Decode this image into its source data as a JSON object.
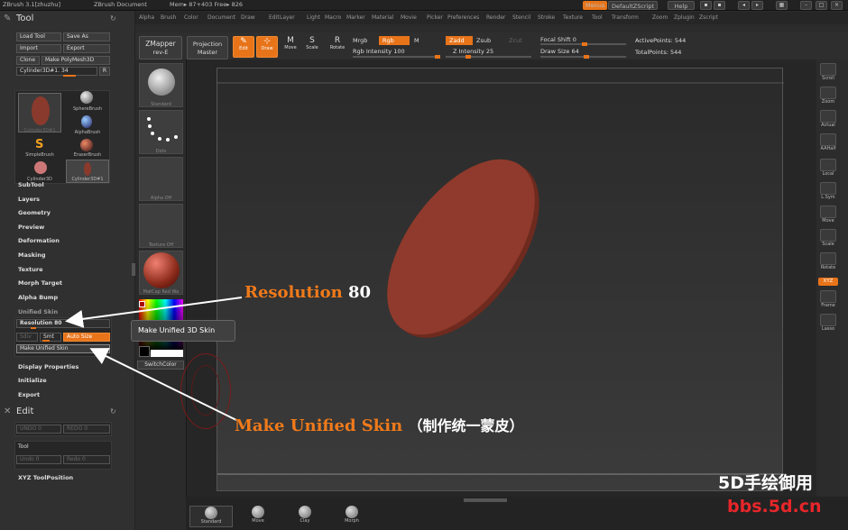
{
  "topbar": {
    "app": "ZBrush 3.1[zhuzhu]",
    "doc": "ZBrush Document",
    "mem": "Mem▸ 87+403 Free▸ 826",
    "menus_label": "Menus",
    "script_label": "DefaultZScript",
    "help_label": "Help"
  },
  "menu": [
    "Alpha",
    "Brush",
    "Color",
    "Document",
    "Draw",
    "Edit",
    "Layer",
    "Light",
    "Macro",
    "Marker",
    "Material",
    "Movie",
    "Picker",
    "Preferences",
    "Render",
    "Stencil",
    "Stroke",
    "Texture",
    "Tool",
    "Transform",
    "Zoom",
    "Zplugin",
    "Zscript"
  ],
  "toolpalette": {
    "title": "Tool",
    "load": "Load Tool",
    "saveas": "Save As",
    "import": "Import",
    "export": "Export",
    "clone": "Clone",
    "make_polymesh": "Make PolyMesh3D",
    "current_tool": "Cylinder3D#1. 34",
    "r_label": "R",
    "thumbs": [
      "Cylinder3D#1",
      "SphereBrush",
      "AlphaBrush",
      "SimpleBrush",
      "EraserBrush",
      "Cylinder3D",
      "Cylinder3D#1"
    ],
    "sections": [
      "SubTool",
      "Layers",
      "Geometry",
      "Preview",
      "Deformation",
      "Masking",
      "Texture",
      "Morph Target",
      "Alpha Bump",
      "Unified Skin"
    ],
    "resolution_label": "Resolution 80",
    "sdiv_label": "Sdiv",
    "smt_label": "Smt",
    "autosize_label": "Auto Size",
    "make_skin_label": "Make Unified Skin",
    "lower_sections": [
      "Display Properties",
      "Initialize",
      "Export"
    ]
  },
  "editpalette": {
    "title": "Edit",
    "undo": "UNDO 0",
    "redo": "REDO 0",
    "tool_label": "Tool",
    "undo2": "Undo 0",
    "redo2": "Redo 0",
    "xyz_label": "XYZ ToolPosition"
  },
  "toptools": {
    "zmapper": "ZMapper",
    "zmapper_sub": "rev-E",
    "projection": "Projection",
    "projection_sub": "Master",
    "edit": "Edit",
    "draw": "Draw",
    "move": "Move",
    "scale": "Scale",
    "rotate": "Rotate",
    "mrgb": "Mrgb",
    "rgb": "Rgb",
    "m": "M",
    "rgb_intensity": "Rgb Intensity 100",
    "zadd": "Zadd",
    "zsub": "Zsub",
    "zcut": "Zcut",
    "z_intensity": "Z Intensity 25",
    "focal_shift": "Focal Shift 0",
    "draw_size": "Draw Size 64",
    "active_points": "ActivePoints: 544",
    "total_points": "TotalPoints: 544"
  },
  "shelf": {
    "items": [
      "Standard",
      "Dots",
      "Alpha Off",
      "Texture Off",
      "MatCap Red Wa"
    ],
    "switch_color": "SwitchColor"
  },
  "popup": "Make Unified 3D Skin",
  "rightshelf": [
    "Scroll",
    "Zoom",
    "Actual",
    "AAHalf",
    "Local",
    "L.Sym",
    "Move",
    "Scale",
    "Rotate",
    "XYZ",
    "Frame",
    "Lasso"
  ],
  "bottombrushes": [
    "Standard",
    "Move",
    "Clay",
    "Morph"
  ],
  "annotations": {
    "resolution_text": "Resolution",
    "resolution_value": "80",
    "make_skin_text": "Make Unified Skin",
    "make_skin_cn": "（制作统一蒙皮）"
  },
  "watermark": {
    "line1": "5D手绘御用",
    "line2": "bbs.5d.cn"
  },
  "colors": {
    "accent": "#e8741a",
    "mesh": "#8a3a2c",
    "annotation": "#f07a1a",
    "watermark_red": "#e8262a"
  }
}
